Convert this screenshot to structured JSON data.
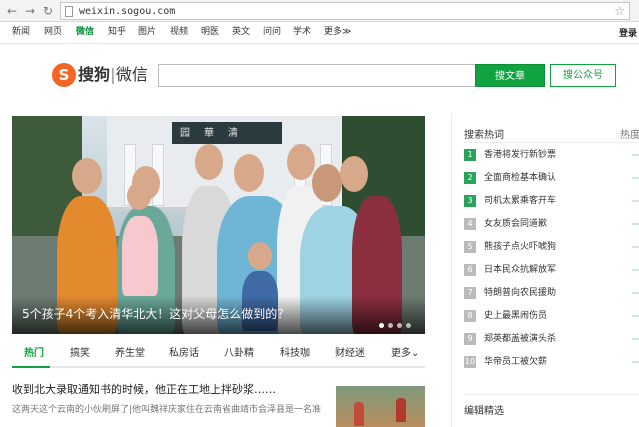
{
  "browser": {
    "url": "weixin.sogou.com",
    "back_glyph": "←",
    "forward_glyph": "→",
    "reload_glyph": "↻",
    "star_glyph": "☆"
  },
  "topnav": {
    "items": [
      "新闻",
      "网页",
      "微信",
      "知乎",
      "图片",
      "视频",
      "明医",
      "英文",
      "问问",
      "学术",
      "更多≫"
    ],
    "active_index": 2,
    "login": "登录"
  },
  "logo": {
    "mark": "S",
    "brand": "搜狗",
    "sub": "微信"
  },
  "search": {
    "query": "",
    "search_article_label": "搜文章",
    "search_account_label": "搜公众号"
  },
  "hero": {
    "gate_text": "园華清",
    "caption": "5个孩子4个考入清华北大！这对父母怎么做到的？",
    "slide_count": 4,
    "active_slide": 1
  },
  "categories": {
    "items": [
      "热门",
      "搞笑",
      "养生堂",
      "私房话",
      "八卦精",
      "科技咖",
      "财经迷",
      "更多⌄"
    ],
    "active_index": 0
  },
  "article": {
    "title": "收到北大录取通知书的时候，他正在工地上拌砂浆……",
    "snippet": "这两天这个云南的小伙刷屏了|他叫魏祥庆家住在云南省曲靖市会泽县是一名准"
  },
  "sidebar": {
    "title": "搜索热词",
    "subtitle": "热度",
    "hot_words": [
      "香港将发行新钞票",
      "全面商检基本确认",
      "司机太累乘客开车",
      "女友质会同道歉",
      "熊孩子点火吓唬狗",
      "日本民众抗解放军",
      "特朗普向农民援助",
      "史上最黑闹伤员",
      "郑英都盖被演头杀",
      "华帝员工被欠薪"
    ],
    "hot_nums": [
      "1",
      "2",
      "3",
      "4",
      "5",
      "6",
      "7",
      "8",
      "9",
      "10"
    ],
    "edit_title": "编辑精选"
  },
  "colors": {
    "accent_green": "#11a340",
    "logo_orange": "#f26522"
  }
}
